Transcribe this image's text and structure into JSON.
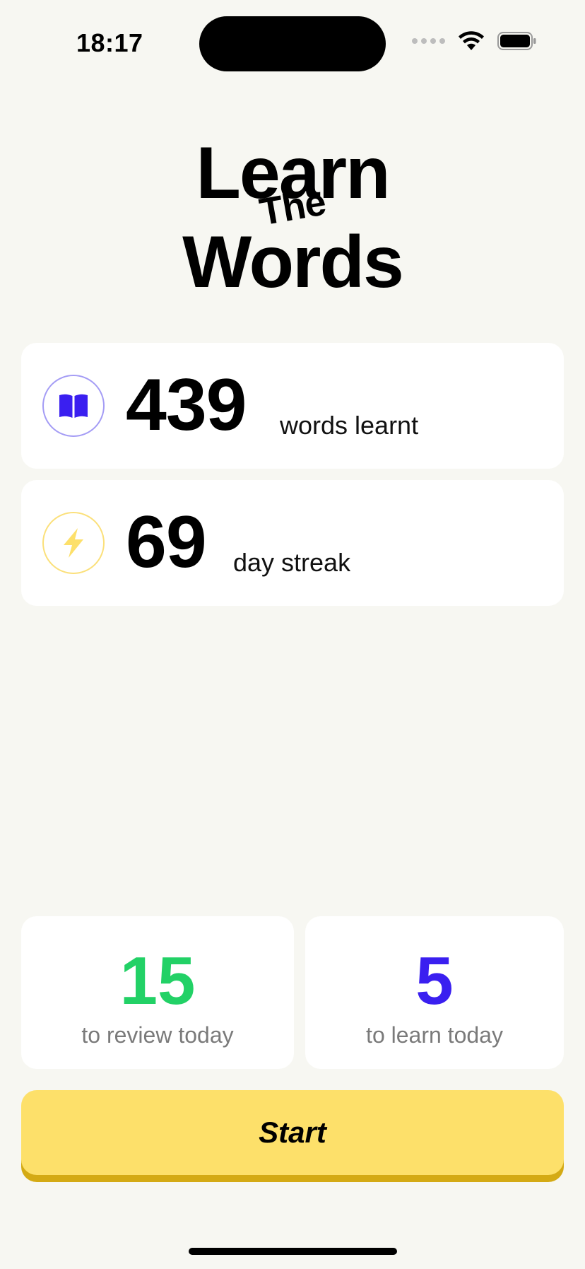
{
  "status_bar": {
    "time": "18:17",
    "icons": [
      "cellular-signal-icon",
      "wifi-icon",
      "battery-icon"
    ]
  },
  "title": {
    "line1": "Learn",
    "line2": "The",
    "line3": "Words"
  },
  "stats": [
    {
      "icon": "book-icon",
      "value": "439",
      "label": "words learnt",
      "icon_color": "#3a1ff0"
    },
    {
      "icon": "lightning-icon",
      "value": "69",
      "label": "day streak",
      "icon_color": "#fde06a"
    }
  ],
  "today": {
    "review": {
      "value": "15",
      "label": "to review today",
      "color": "#22d166"
    },
    "learn": {
      "value": "5",
      "label": "to learn today",
      "color": "#3a1ff0"
    }
  },
  "start_button": {
    "label": "Start",
    "color": "#fde06a"
  }
}
